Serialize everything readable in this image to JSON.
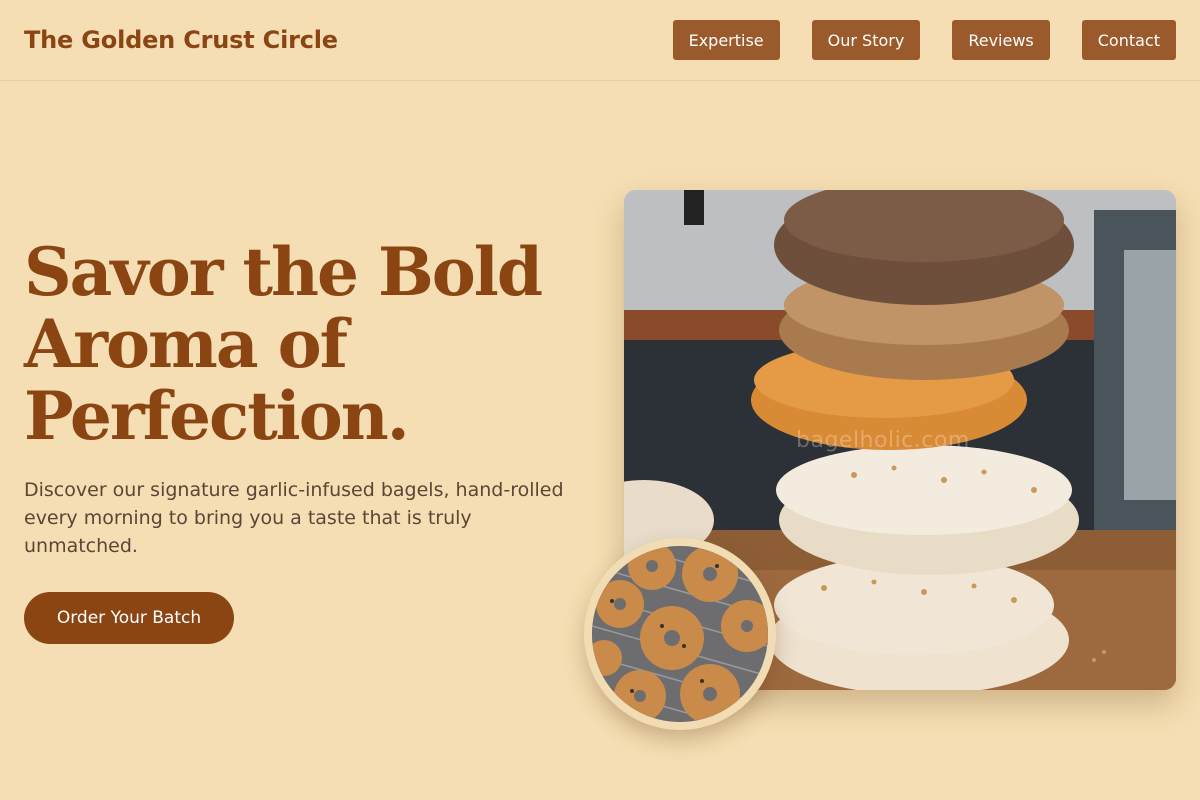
{
  "header": {
    "brand": "The Golden Crust Circle",
    "nav": [
      "Expertise",
      "Our Story",
      "Reviews",
      "Contact"
    ]
  },
  "hero": {
    "title_lines": [
      "Savor the Bold",
      "Aroma of",
      "Perfection."
    ],
    "subtitle": "Discover our signature garlic-infused bagels, hand-rolled every morning to bring you a taste that is truly unmatched.",
    "cta_label": "Order Your Batch"
  },
  "images": {
    "main_photo": "stacked-bagels-photo",
    "main_watermark": "bagelholic.com",
    "circle_photo": "bagels-on-cooling-rack-photo"
  },
  "colors": {
    "background": "#f5deb3",
    "brand_brown": "#8b4513",
    "nav_button": "#9a5a2b",
    "body_text": "#5a4636"
  }
}
